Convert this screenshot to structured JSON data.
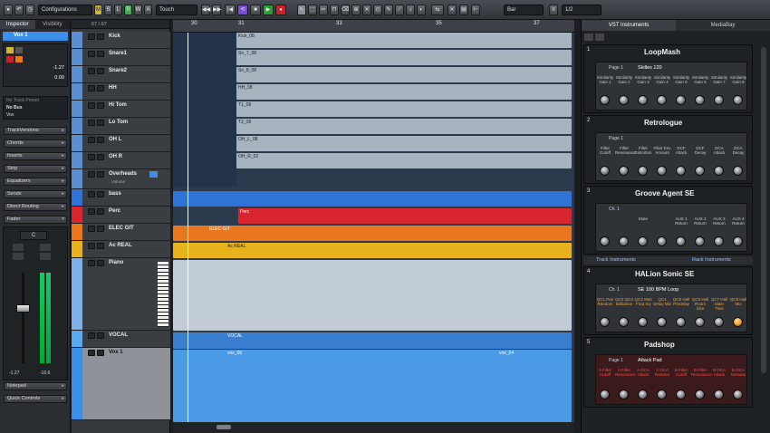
{
  "toolbar": {
    "mode_touch": "Touch",
    "configurations": "Configurations",
    "snap_value": "Bar",
    "quantize": "1/2",
    "btn_m": "M",
    "btn_s": "S",
    "btn_l": "L",
    "btn_r": "R",
    "btn_w": "W",
    "btn_a": "A"
  },
  "inspector": {
    "tabs": [
      "Inspector",
      "Visibility"
    ],
    "track_name": "Vox 1",
    "volume_value": "-1.27",
    "pan_value": "0.00",
    "routing": [
      "No Track Preset",
      "No Bus",
      "Vox"
    ],
    "sections": [
      "TrackVersions",
      "Chords",
      "Inserts",
      "Strip",
      "Equalizers",
      "Sends",
      "Direct Routing",
      "Fader"
    ],
    "bottom_sections": [
      "Notepad",
      "Quick Controls"
    ],
    "channel_label": "C",
    "meter_left": "-1.27",
    "meter_right": "-10.6"
  },
  "tracklist": {
    "header": "67 / 67",
    "tracks": [
      {
        "name": "Kick"
      },
      {
        "name": "Snare1"
      },
      {
        "name": "Snare2"
      },
      {
        "name": "HH"
      },
      {
        "name": "Hi Tom"
      },
      {
        "name": "Lo Tom"
      },
      {
        "name": "OH L"
      },
      {
        "name": "OH R"
      },
      {
        "name": "Overheads"
      },
      {
        "name": "bass"
      },
      {
        "name": "Perc"
      },
      {
        "name": "ELEC GIT"
      },
      {
        "name": "Ac REAL"
      },
      {
        "name": "Piano"
      },
      {
        "name": "VOCAL"
      },
      {
        "name": "Vox 1"
      }
    ],
    "overheads_param": "Volume"
  },
  "ruler": {
    "bars": [
      "30",
      "31",
      "33",
      "35",
      "37"
    ],
    "bar_positions_label": "30"
  },
  "events": {
    "kick": "Kick_08",
    "sn7": "Sn_7_08",
    "sn8": "Sn_8_08",
    "hh": "HH_08",
    "t1": "T1_08",
    "t2": "T2_08",
    "ohl": "OH_L_08",
    "ohr": "OH_R_02",
    "perc": "Perc",
    "elec_git": "ELEC GIT",
    "ac_real": "Ac REAL",
    "vocal": "VOCAL",
    "vox_06": "vox_06",
    "vox_04": "vox_04"
  },
  "rack": {
    "tabs": [
      "VST Instruments",
      "MediaBay"
    ],
    "section_track": "Track Instruments",
    "section_rack": "Rack Instruments",
    "slots": [
      {
        "num": "1",
        "name": "LoopMash",
        "page": "Page 1",
        "preset": "Skillex 120",
        "labels": [
          "Similarity Gain 1",
          "Similarity Gain 2",
          "Similarity Gain 3",
          "Similarity Gain 4",
          "Similarity Gain 5",
          "Similarity Gain 6",
          "Similarity Gain 7",
          "Similarity Gain 8"
        ]
      },
      {
        "num": "2",
        "name": "Retrologue",
        "page": "Page 1",
        "labels": [
          "Filter Cutoff",
          "Filter Resonance",
          "Filter Distortion",
          "Filter Env Amount",
          "DCF Attack",
          "DCF Decay",
          "DCA Attack",
          "DCA Decay"
        ]
      },
      {
        "num": "3",
        "name": "Groove Agent SE",
        "page": "Ch. 1",
        "labels": [
          "Mute",
          "AUX 1 Return",
          "AUX 2 Return",
          "AUX 3 Return",
          "AUX 4 Return"
        ]
      },
      {
        "num": "4",
        "name": "HALion Sonic SE",
        "page": "Ch. 1",
        "preset": "SE 100 BPM Loop",
        "labels": [
          "QC1 Pan Random",
          "QC2 QC3 Brilliance",
          "QC3 Wait Freq Sq",
          "QC4 Delay Mix",
          "QC5 Hall Predelay",
          "QC6 Hall Room Size",
          "QC7 Hall Main Time",
          "QC8 Hall Mix"
        ]
      },
      {
        "num": "5",
        "name": "Padshop",
        "page": "Page 1",
        "preset": "Attack Pad",
        "labels": [
          "A Filter Cutoff",
          "A Filter Resonance",
          "A OCA Attack",
          "A OCA Release",
          "B Filter Cutoff",
          "B Filter Resonance",
          "B OCA Attack",
          "B OCA Release"
        ]
      }
    ]
  },
  "colors": {
    "accent_blue": "#3b8fe8",
    "bass": "#2f73d6",
    "perc": "#d9262e",
    "elec_git": "#e8771d",
    "ac_real": "#e8b21d",
    "piano": "#7fb0e6",
    "vocal": "#5aa9ef"
  }
}
